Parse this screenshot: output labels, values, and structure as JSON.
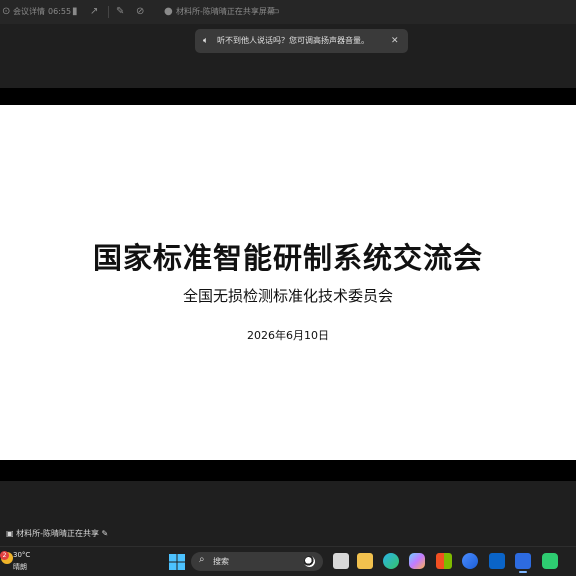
{
  "toolbar": {
    "meeting_info": "会议详情",
    "elapsed": "06:55",
    "sharing_banner": "材料所-陈晴晴正在共享屏幕"
  },
  "toast": {
    "message": "听不到他人说话吗？您可调高扬声器音量。"
  },
  "slide": {
    "title": "国家标准智能研制系统交流会",
    "subtitle": "全国无损检测标准化技术委员会",
    "date": "2026年6月10日"
  },
  "share_status": {
    "text": "材料所-陈晴晴正在共享"
  },
  "taskbar": {
    "weather_badge": "2",
    "temperature": "30°C",
    "weather": "晴朗",
    "search_label": "搜索",
    "apps": [
      "task-view-icon",
      "file-explorer-icon",
      "edge-icon",
      "copilot-icon",
      "store-icon",
      "app-icon",
      "outlook-icon",
      "meeting-app-icon",
      "chat-app-icon"
    ]
  }
}
